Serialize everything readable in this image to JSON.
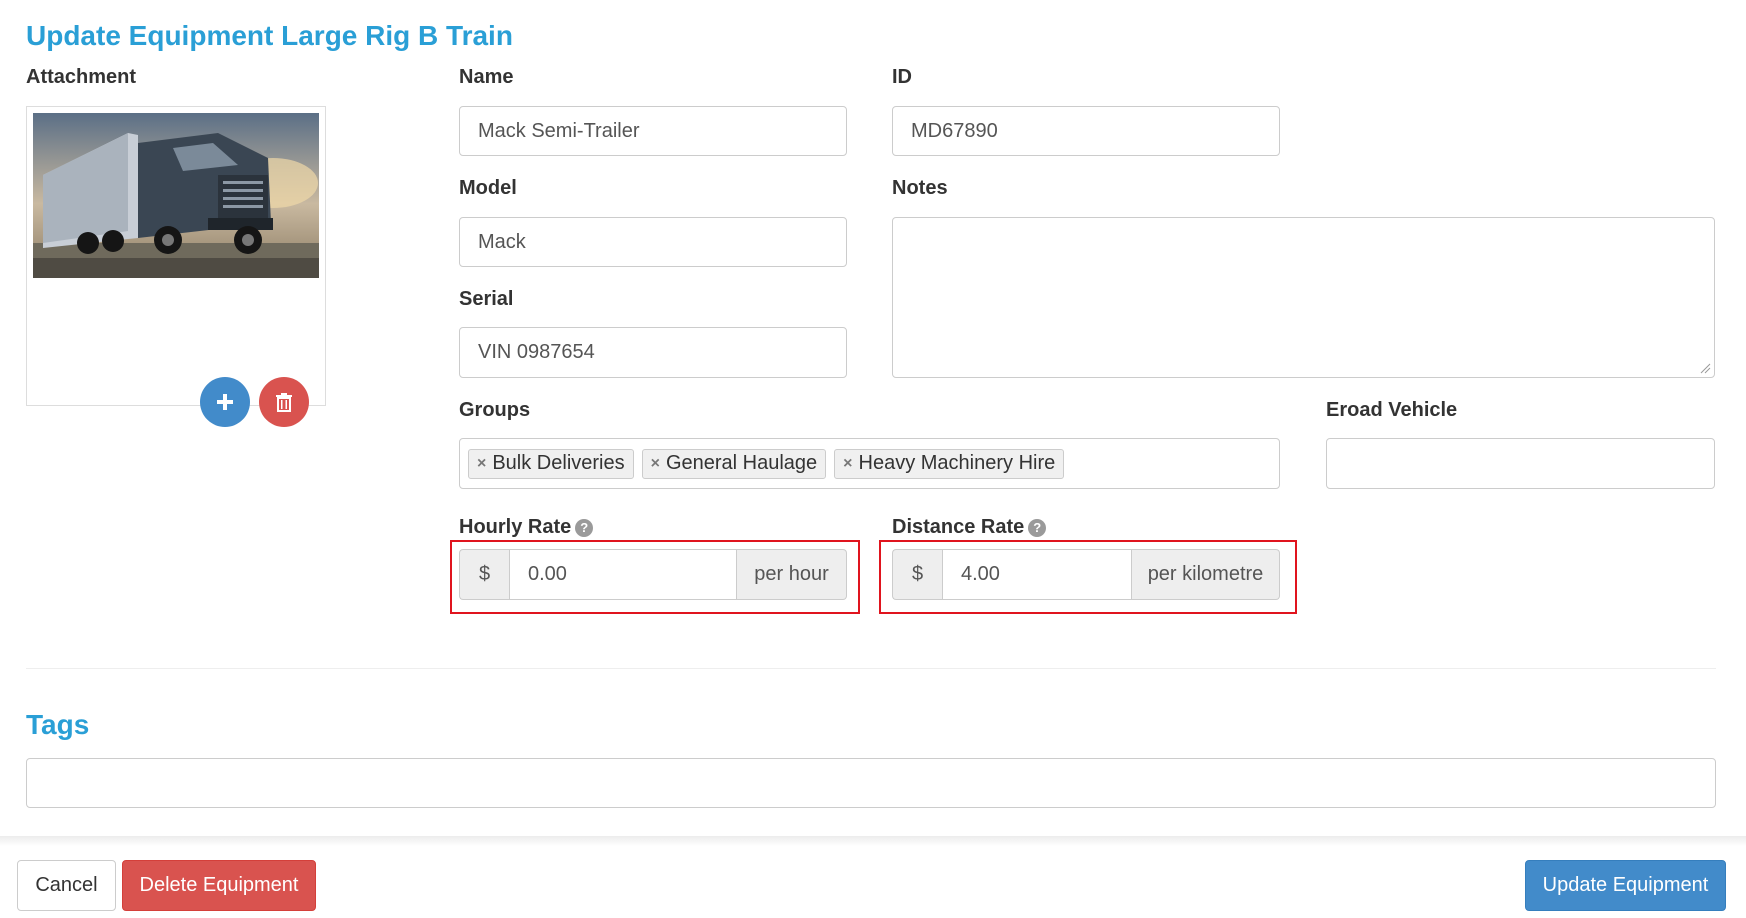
{
  "page": {
    "title": "Update Equipment Large Rig B Train"
  },
  "attachment": {
    "label": "Attachment",
    "image_icon": "truck-photo",
    "add_icon": "plus-icon",
    "delete_icon": "trash-icon"
  },
  "fields": {
    "name": {
      "label": "Name",
      "value": "Mack Semi-Trailer"
    },
    "id": {
      "label": "ID",
      "value": "MD67890"
    },
    "model": {
      "label": "Model",
      "value": "Mack"
    },
    "notes": {
      "label": "Notes",
      "value": ""
    },
    "serial": {
      "label": "Serial",
      "value": "VIN 0987654"
    },
    "groups": {
      "label": "Groups",
      "items": [
        "Bulk Deliveries",
        "General Haulage",
        "Heavy Machinery Hire"
      ]
    },
    "eroad": {
      "label": "Eroad Vehicle",
      "value": ""
    },
    "hourly_rate": {
      "label": "Hourly Rate",
      "prefix": "$",
      "value": "0.00",
      "suffix": "per hour"
    },
    "distance_rate": {
      "label": "Distance Rate",
      "prefix": "$",
      "value": "4.00",
      "suffix": "per kilometre"
    }
  },
  "tags": {
    "heading": "Tags",
    "value": ""
  },
  "footer": {
    "cancel_label": "Cancel",
    "delete_label": "Delete Equipment",
    "update_label": "Update Equipment"
  },
  "colors": {
    "accent": "#2a9fd6",
    "danger": "#d9534f",
    "primary": "#428bca",
    "highlight": "#e0141e"
  }
}
